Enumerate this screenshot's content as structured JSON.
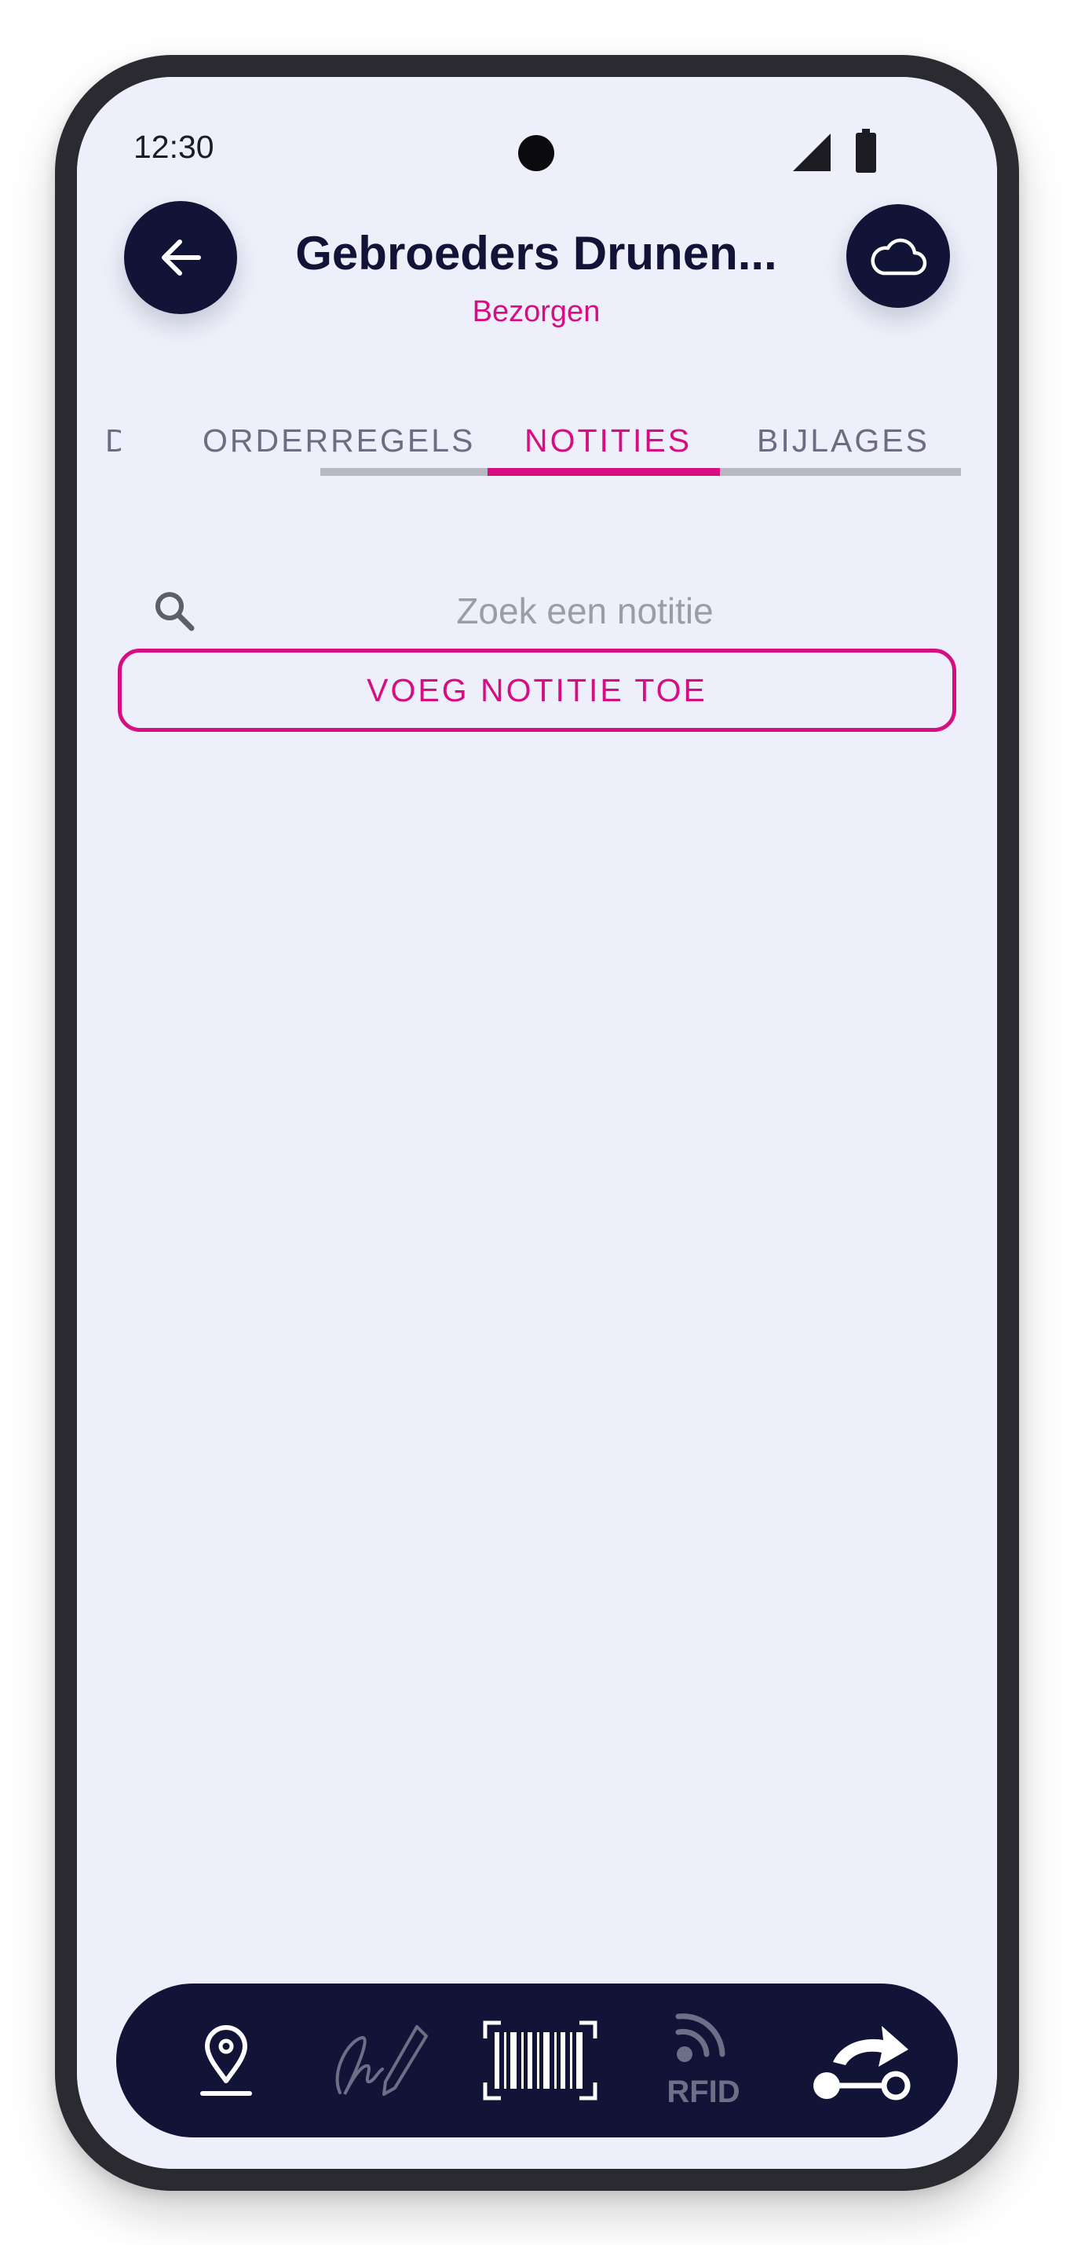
{
  "status_bar": {
    "time": "12:30"
  },
  "header": {
    "title": "Gebroeders Drunen...",
    "subtitle": "Bezorgen",
    "back_icon": "arrow-left-icon",
    "sync_icon": "cloud-icon"
  },
  "tabs": [
    {
      "label": "D",
      "active": false
    },
    {
      "label": "ORDERREGELS",
      "active": false
    },
    {
      "label": "NOTITIES",
      "active": true
    },
    {
      "label": "BIJLAGES",
      "active": false
    }
  ],
  "search": {
    "placeholder": "Zoek een notitie",
    "value": ""
  },
  "add_note_button": {
    "label": "VOEG NOTITIE TOE"
  },
  "bottom_nav": {
    "items": [
      {
        "icon": "location-pin-icon",
        "active": true
      },
      {
        "icon": "signature-icon",
        "active": false
      },
      {
        "icon": "barcode-scan-icon",
        "active": true
      },
      {
        "icon": "rfid-icon",
        "label": "RFID",
        "active": false
      },
      {
        "icon": "route-forward-icon",
        "active": true
      }
    ]
  },
  "colors": {
    "accent": "#d70e83",
    "navy": "#121437",
    "background": "#edf0fa",
    "tab_inactive": "#6b6e83"
  }
}
